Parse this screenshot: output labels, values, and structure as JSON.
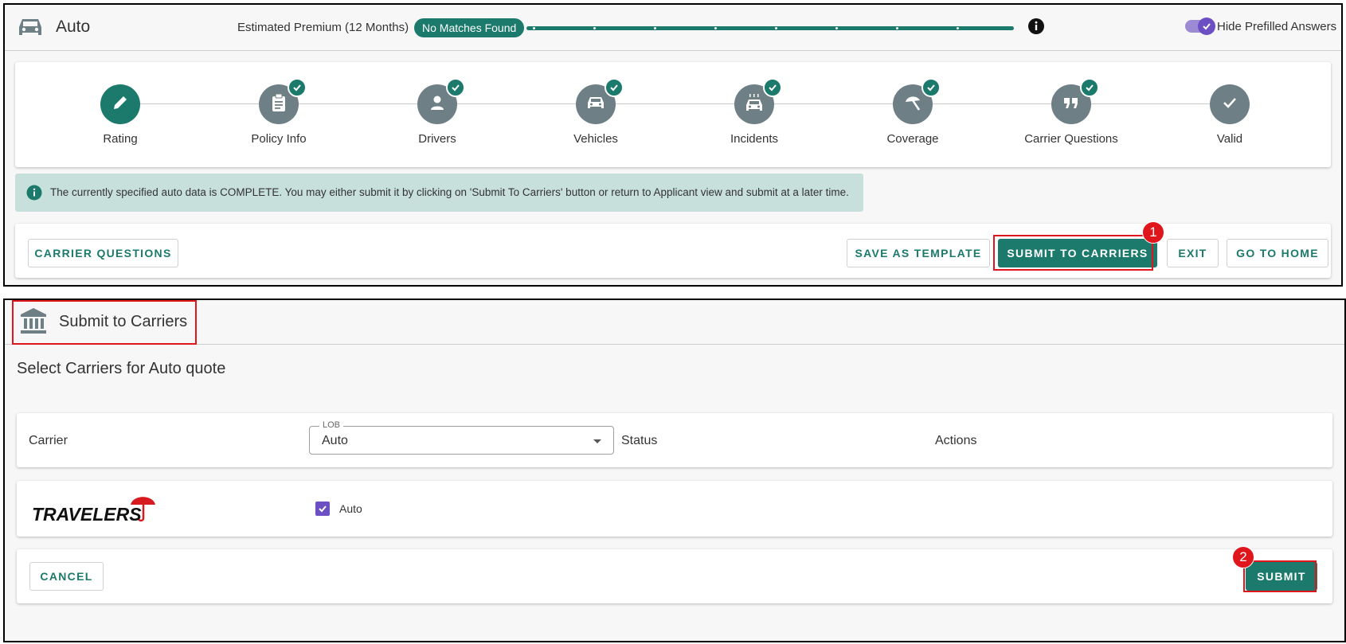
{
  "header": {
    "title": "Auto",
    "premium_label": "Estimated Premium (12 Months)",
    "premium_badge": "No Matches Found",
    "toggle_label": "Hide Prefilled Answers"
  },
  "stepper": {
    "steps": [
      {
        "label": "Rating",
        "icon": "pencil-icon",
        "completed": false,
        "active": true
      },
      {
        "label": "Policy Info",
        "icon": "clipboard-icon",
        "completed": true
      },
      {
        "label": "Drivers",
        "icon": "person-icon",
        "completed": true
      },
      {
        "label": "Vehicles",
        "icon": "car-icon",
        "completed": true
      },
      {
        "label": "Incidents",
        "icon": "car-crash-icon",
        "completed": true
      },
      {
        "label": "Coverage",
        "icon": "umbrella-icon",
        "completed": true
      },
      {
        "label": "Carrier Questions",
        "icon": "quote-icon",
        "completed": true
      },
      {
        "label": "Valid",
        "icon": "check-icon",
        "completed": false
      }
    ]
  },
  "alert": {
    "text": "The currently specified auto data is COMPLETE. You may either submit it by clicking on 'Submit To Carriers' button or return to Applicant view and submit at a later time."
  },
  "actions": {
    "carrier_questions": "CARRIER QUESTIONS",
    "save_as_template": "SAVE AS TEMPLATE",
    "submit_to_carriers": "SUBMIT TO CARRIERS",
    "exit": "EXIT",
    "go_to_home": "GO TO HOME"
  },
  "markers": {
    "one": "1",
    "two": "2"
  },
  "submit_panel": {
    "title": "Submit to Carriers",
    "section_title": "Select Carriers for Auto quote",
    "table": {
      "col_carrier": "Carrier",
      "lob_legend": "LOB",
      "lob_value": "Auto",
      "col_status": "Status",
      "col_actions": "Actions"
    },
    "carrier": {
      "logo_text": "TRAVELERS",
      "checkbox_label": "Auto",
      "checked": true
    },
    "cancel": "CANCEL",
    "submit": "SUBMIT"
  },
  "colors": {
    "primary": "#1b7a6b",
    "highlight": "#e0161d",
    "accent_purple": "#6b4fc3",
    "alert_bg": "#c8e0dc"
  }
}
